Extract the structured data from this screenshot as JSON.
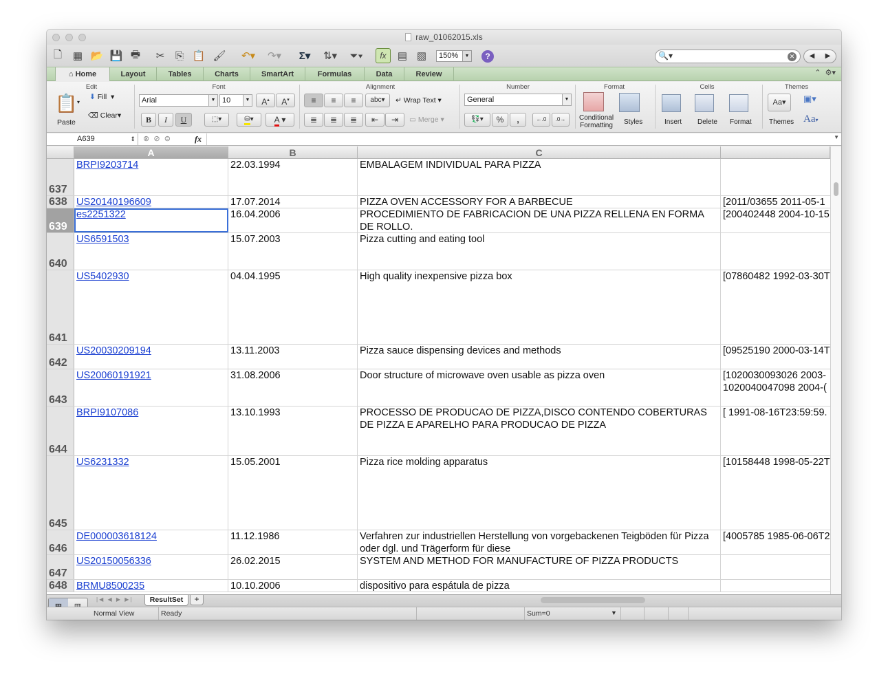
{
  "window": {
    "title": "raw_01062015.xls",
    "zoom": "150%"
  },
  "ribbon": {
    "tabs": [
      "Home",
      "Layout",
      "Tables",
      "Charts",
      "SmartArt",
      "Formulas",
      "Data",
      "Review"
    ],
    "active_tab": "Home",
    "groups": {
      "edit": "Edit",
      "font": "Font",
      "alignment": "Alignment",
      "number": "Number",
      "format": "Format",
      "cells": "Cells",
      "themes": "Themes"
    },
    "paste_label": "Paste",
    "fill_label": "Fill",
    "clear_label": "Clear",
    "font_name": "Arial",
    "font_size": "10",
    "bold": "B",
    "italic": "I",
    "underline": "U",
    "wrap_text": "Wrap Text",
    "merge": "Merge",
    "abc": "abc",
    "number_format": "General",
    "percent": "%",
    "comma": ",",
    "cond_format_line1": "Conditional",
    "cond_format_line2": "Formatting",
    "styles": "Styles",
    "insert": "Insert",
    "delete": "Delete",
    "format": "Format",
    "themes": "Themes",
    "aa_small": "Aa",
    "aa_big": "Aa"
  },
  "formula_bar": {
    "name_box": "A639",
    "fx": "fx",
    "formula": ""
  },
  "grid": {
    "columns": [
      "A",
      "B",
      "C"
    ],
    "selected_column": "A",
    "rows": [
      {
        "num": "637",
        "a": "BRPI9203714",
        "b": "22.03.1994",
        "c": "EMBALAGEM INDIVIDUAL PARA PIZZA",
        "d": ""
      },
      {
        "num": "638",
        "a": "US20140196609",
        "b": "17.07.2014",
        "c": "PIZZA OVEN ACCESSORY FOR A BARBECUE",
        "d": "[2011/03655 2011-05-1"
      },
      {
        "num": "639",
        "a": "es2251322",
        "b": "16.04.2006",
        "c": "PROCEDIMIENTO DE FABRICACION DE UNA PIZZA RELLENA EN FORMA DE ROLLO.",
        "d": "[200402448 2004-10-15"
      },
      {
        "num": "640",
        "a": "US6591503",
        "b": "15.07.2003",
        "c": "Pizza cutting and eating tool",
        "d": ""
      },
      {
        "num": "641",
        "a": "US5402930",
        "b": "04.04.1995",
        "c": "High quality inexpensive pizza box",
        "d": "[07860482 1992-03-30T"
      },
      {
        "num": "642",
        "a": "US20030209194",
        "b": "13.11.2003",
        "c": "Pizza sauce dispensing devices and methods",
        "d": "[09525190 2000-03-14T"
      },
      {
        "num": "643",
        "a": "US20060191921",
        "b": "31.08.2006",
        "c": "Door structure of microwave oven usable as pizza oven",
        "d": "[1020030093026 2003-\n1020040047098 2004-("
      },
      {
        "num": "644",
        "a": "BRPI9107086",
        "b": "13.10.1993",
        "c": "PROCESSO DE PRODUCAO DE PIZZA,DISCO CONTENDO COBERTURAS DE PIZZA E APARELHO PARA PRODUCAO DE PIZZA",
        "d": "[ 1991-08-16T23:59:59."
      },
      {
        "num": "645",
        "a": "US6231332",
        "b": "15.05.2001",
        "c": "Pizza rice molding apparatus",
        "d": "[10158448 1998-05-22T"
      },
      {
        "num": "646",
        "a": "DE000003618124",
        "b": "11.12.1986",
        "c": "Verfahren zur industriellen Herstellung von vorgebackenen Teigböden für Pizza oder dgl. und Trägerform für diese",
        "d": "[4005785 1985-06-06T2"
      },
      {
        "num": "647",
        "a": "US20150056336",
        "b": "26.02.2015",
        "c": "SYSTEM AND METHOD FOR MANUFACTURE OF PIZZA PRODUCTS",
        "d": ""
      },
      {
        "num": "648",
        "a": "BRMU8500235",
        "b": "10.10.2006",
        "c": "dispositivo para espátula de pizza",
        "d": ""
      }
    ],
    "selected_cell": "A639"
  },
  "sheets": {
    "active": "ResultSet",
    "add": "+"
  },
  "status": {
    "view": "Normal View",
    "state": "Ready",
    "sum": "Sum=0"
  }
}
